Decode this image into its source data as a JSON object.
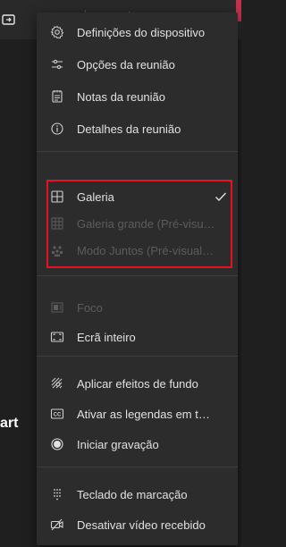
{
  "background_text": "art",
  "toolbar": {
    "share_icon": "share-screen-icon",
    "more_icon": "more-options-icon",
    "camera_icon": "camera-off-icon",
    "mic_icon": "microphone-icon",
    "share_tray_icon": "share-tray-icon",
    "more_label": "•••"
  },
  "menu": {
    "items": [
      {
        "label": "Definições do dispositivo",
        "icon": "gear-icon"
      },
      {
        "label": "Opções da reunião",
        "icon": "options-icon"
      },
      {
        "label": "Notas da reunião",
        "icon": "notes-icon"
      },
      {
        "label": "Detalhes da reunião",
        "icon": "info-icon"
      },
      {
        "label": "Galeria",
        "icon": "gallery-icon",
        "checked": true
      },
      {
        "label": "Galeria grande (Pré-visualização)",
        "icon": "large-gallery-icon",
        "disabled": true
      },
      {
        "label": "Modo Juntos (Pré-visualização)",
        "icon": "together-mode-icon",
        "disabled": true
      },
      {
        "label": "Foco",
        "icon": "focus-icon",
        "disabled": true
      },
      {
        "label": "Ecrã inteiro",
        "icon": "fullscreen-icon"
      },
      {
        "label": "Aplicar efeitos de fundo",
        "icon": "background-effects-icon"
      },
      {
        "label": "Ativar as legendas em tempo real",
        "icon": "captions-icon"
      },
      {
        "label": "Iniciar gravação",
        "icon": "record-icon"
      },
      {
        "label": "Teclado de marcação",
        "icon": "dialpad-icon"
      },
      {
        "label": "Desativar vídeo recebido",
        "icon": "video-off-icon"
      }
    ]
  },
  "colors": {
    "menu_background": "#2d2c2c",
    "text": "#e1e1e1",
    "disabled_text": "#5c5c5c",
    "highlight_border": "#e81123",
    "separator": "#3e3e3e",
    "status_red": "#c4314b"
  }
}
